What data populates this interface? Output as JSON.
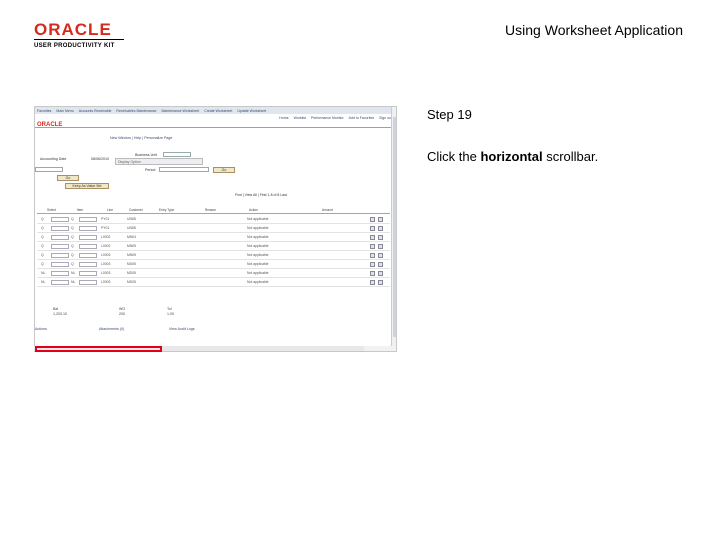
{
  "header": {
    "logo_word": "ORACLE",
    "logo_sub": "USER PRODUCTIVITY KIT",
    "doc_title": "Using Worksheet Application"
  },
  "step": {
    "label": "Step 19",
    "instruction_before": "Click the ",
    "instruction_bold": "horizontal",
    "instruction_after": " scrollbar."
  },
  "screenshot": {
    "menu_items": [
      "Favorites",
      "Main Menu",
      "Accounts Receivable",
      "Receivables Maintenance",
      "Maintenance Worksheet",
      "Create Worksheet",
      "Update Worksheet"
    ],
    "app_logo": "ORACLE",
    "top_links": [
      "Home",
      "Worklist",
      "Performance Monitor",
      "Add to Favorites",
      "Sign out"
    ],
    "new_window": "New Window | Help | Personalize Page",
    "field_labels": [
      "Accounting Date",
      "Business Unit",
      "Display Option",
      "Period"
    ],
    "accounting_date": "08/06/2010",
    "go_button": "Go",
    "keep_value_button": "Keep As Value Set",
    "grid_nav": "Find | View All | First 1-8 of 8 Last",
    "grid_headers": [
      "Select",
      "Item",
      "Line",
      "Customer",
      "Entry Type",
      "Reason",
      "Action",
      "Amount"
    ],
    "rows": [
      {
        "col1": "Q",
        "col2": "Q",
        "col3": "PY01",
        "col4": "UN5D",
        "col5": "Not applicable"
      },
      {
        "col1": "Q",
        "col2": "Q",
        "col3": "PY01",
        "col4": "UN5D",
        "col5": "Not applicable"
      },
      {
        "col1": "Q",
        "col2": "Q",
        "col3": "L0002",
        "col4": "MN04",
        "col5": "Not applicable"
      },
      {
        "col1": "Q",
        "col2": "Q",
        "col3": "L0002",
        "col4": "MN05",
        "col5": "Not applicable"
      },
      {
        "col1": "Q",
        "col2": "Q",
        "col3": "L0003",
        "col4": "MN05",
        "col5": "Not applicable"
      },
      {
        "col1": "Q",
        "col2": "Q",
        "col3": "L0003",
        "col4": "MD05",
        "col5": "Not applicable"
      },
      {
        "col1": "NL",
        "col2": "NL",
        "col3": "L0003",
        "col4": "MD05",
        "col5": "Not applicable"
      },
      {
        "col1": "NL",
        "col2": "NL",
        "col3": "L0003",
        "col4": "MD05",
        "col5": "Not applicable"
      }
    ],
    "totals_labels": [
      "Bal",
      "WO",
      "Tol"
    ],
    "totals_values": [
      "1,203.10",
      "200",
      "1.00"
    ],
    "footer_links": [
      "Actions",
      "Attachments (0)",
      "View Audit Logs"
    ]
  },
  "colors": {
    "oracle_red": "#d52b1e",
    "highlight": "#e0001b"
  }
}
